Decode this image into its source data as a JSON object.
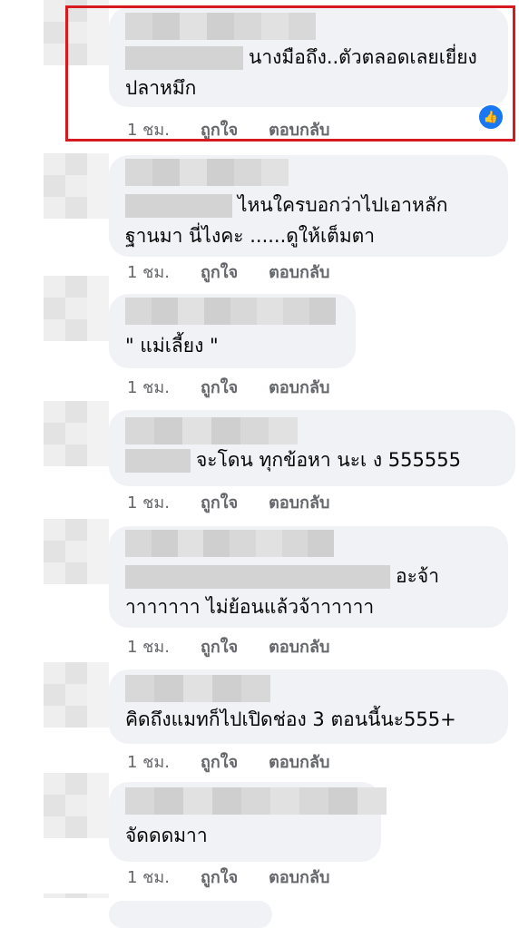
{
  "comments": [
    {
      "text_lines": [
        "นางมือถึง..ตัวตลอดเลยเยี่ยง",
        "ปลาหมึก"
      ],
      "time": "1 ชม.",
      "like": "ถูกใจ",
      "reply": "ตอบกลับ"
    },
    {
      "text_lines": [
        "ไหนใครบอกว่าไปเอาหลัก",
        "ฐานมา นี่ไงคะ ......ดูให้เต็มตา"
      ],
      "time": "1 ชม.",
      "like": "ถูกใจ",
      "reply": "ตอบกลับ"
    },
    {
      "text_lines": [
        "\" แม่เลี้ยง \""
      ],
      "time": "1 ชม.",
      "like": "ถูกใจ",
      "reply": "ตอบกลับ"
    },
    {
      "text_lines": [
        "จะโดน ทุกข้อหา นะเ  ง    555555"
      ],
      "time": "1 ชม.",
      "like": "ถูกใจ",
      "reply": "ตอบกลับ"
    },
    {
      "text_lines": [
        "อะจ้า",
        " าาาาาาา ไม่ย้อนแล้วจ้าาาาาา"
      ],
      "time": "1 ชม.",
      "like": "ถูกใจ",
      "reply": "ตอบกลับ"
    },
    {
      "text_lines": [
        "คิดถึงแมทก็ไปเปิดช่อง 3 ตอนนี้นะ555+"
      ],
      "time": "1 ชม.",
      "like": "ถูกใจ",
      "reply": "ตอบกลับ"
    },
    {
      "text_lines": [
        "จัดดดมาา"
      ],
      "time": "1 ชม.",
      "like": "ถูกใจ",
      "reply": "ตอบกลับ"
    }
  ],
  "reaction_icon": "like-thumb-icon",
  "colors": {
    "highlight": "#d71920",
    "bubble": "#f0f2f5",
    "meta": "#65676b",
    "like_blue": "#1877f2"
  }
}
